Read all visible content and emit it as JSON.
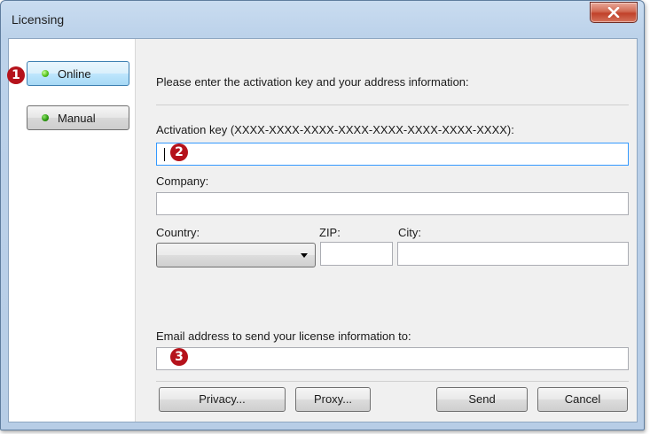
{
  "window": {
    "title": "Licensing"
  },
  "sidebar": {
    "online_label": "Online",
    "manual_label": "Manual"
  },
  "form": {
    "intro": "Please enter the activation key and your address information:",
    "activation_key_label": "Activation key (XXXX-XXXX-XXXX-XXXX-XXXX-XXXX-XXXX-XXXX):",
    "activation_key_value": "",
    "company_label": "Company:",
    "company_value": "",
    "country_label": "Country:",
    "country_value": "",
    "zip_label": "ZIP:",
    "zip_value": "",
    "city_label": "City:",
    "city_value": "",
    "email_label": "Email address to send your license information to:",
    "email_value": ""
  },
  "buttons": {
    "privacy": "Privacy...",
    "proxy": "Proxy...",
    "send": "Send",
    "cancel": "Cancel"
  },
  "callouts": [
    "1",
    "2",
    "3"
  ],
  "colors": {
    "callout": "#b5121b",
    "close_button": "#c9533c",
    "focus_border": "#3399ff",
    "led_green": "#56c21d"
  },
  "icons": {
    "close": "close-x-icon",
    "status_led": "green-led-icon",
    "dropdown": "chevron-down-icon"
  }
}
